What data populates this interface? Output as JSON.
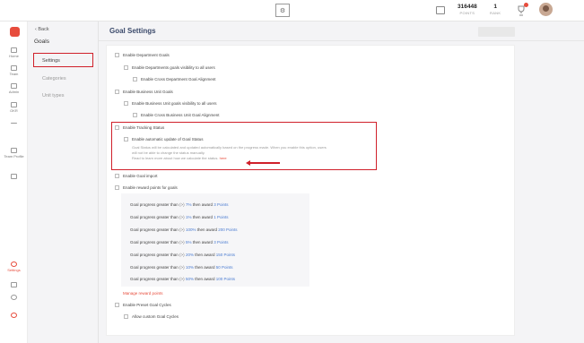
{
  "topbar": {
    "logo_text": "⚙",
    "points_value": "316448",
    "points_label": "POINTS",
    "rank_value": "1",
    "rank_label": "RANK",
    "icons": [
      "megaphone-icon",
      "trophy-icon",
      "avatar"
    ]
  },
  "rail": {
    "items": [
      {
        "label": "Home",
        "icon": "home-icon"
      },
      {
        "label": "Team",
        "icon": "team-icon"
      },
      {
        "label": "Admin",
        "icon": "admin-icon"
      },
      {
        "label": "OKR",
        "icon": "okr-icon"
      },
      {
        "label": "",
        "icon": "minus-icon"
      },
      {
        "label": "Team Profile",
        "icon": "team-profile-icon"
      },
      {
        "label": "",
        "icon": "grid-icon"
      },
      {
        "label": "Settings",
        "icon": "settings-icon"
      },
      {
        "label": "",
        "icon": "download-icon"
      },
      {
        "label": "",
        "icon": "gear-icon"
      },
      {
        "label": "",
        "icon": "help-icon"
      }
    ]
  },
  "subnav": {
    "back": "Back",
    "section": "Goals",
    "items": [
      "Settings",
      "Categories",
      "Unit types"
    ]
  },
  "header": {
    "title": "Goal Settings",
    "save_label": ""
  },
  "settings": {
    "dept": "Enable Department Goals",
    "dept_visibility": "Enable Departments goals visibility to all users",
    "dept_cross": "Enable Cross Department Goal Alignment",
    "bu": "Enable Business Unit Goals",
    "bu_visibility": "Enable Business Unit goals visibility to all users",
    "bu_cross": "Enable Cross Business Unit Goal Alignment",
    "tracking": "Enable Tracking Status",
    "auto_update": "Enable automatic update of Goal Status",
    "desc_1": "Goal Status will be calculated and updated automatically based on the progress made. When you enable this option, users",
    "desc_2": "will not be able to change the status manually.",
    "desc_3": "Read to learn more about how we calculate the status.",
    "desc_link": "here",
    "import": "Enable Goal import",
    "reward_points": "Enable reward points for goals",
    "manage": "Manage reward points",
    "preset": "Enable Preset Goal Cycles",
    "custom": "Allow custom Goal Cycles"
  },
  "rewards": [
    {
      "prefix": "Goal progress greater than",
      "op": "(>)",
      "pct": "7%",
      "mid": "then award",
      "pts": "3 Points"
    },
    {
      "prefix": "Goal progress greater than",
      "op": "(>)",
      "pct": "1%",
      "mid": "then award",
      "pts": "1 Points"
    },
    {
      "prefix": "Goal progress greater than",
      "op": "(>)",
      "pct": "100%",
      "mid": "then award",
      "pts": "200 Points"
    },
    {
      "prefix": "Goal progress greater than",
      "op": "(>)",
      "pct": "5%",
      "mid": "then award",
      "pts": "3 Points"
    },
    {
      "prefix": "Goal progress greater than",
      "op": "(>)",
      "pct": "20%",
      "mid": "then award",
      "pts": "150 Points"
    },
    {
      "prefix": "Goal progress greater than",
      "op": "(>)",
      "pct": "10%",
      "mid": "then award",
      "pts": "50 Points"
    },
    {
      "prefix": "Goal progress greater than",
      "op": "(>)",
      "pct": "50%",
      "mid": "then award",
      "pts": "100 Points"
    }
  ],
  "colors": {
    "accent": "#e74c3c",
    "highlight": "#d0202a",
    "title": "#3b4a6b",
    "points": "#4a7bd0"
  }
}
